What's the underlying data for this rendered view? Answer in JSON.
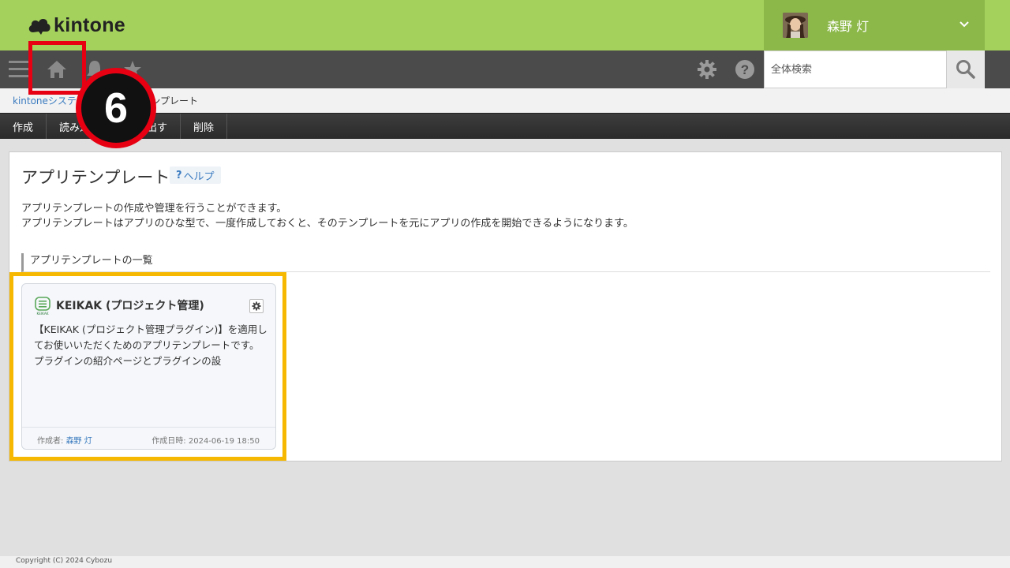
{
  "header": {
    "logo_text": "kintone",
    "user_name": "森野 灯"
  },
  "nav": {
    "icons": [
      "menu-icon",
      "home-icon",
      "bell-icon",
      "star-icon",
      "gear-icon",
      "help-icon",
      "search-icon"
    ],
    "search_placeholder": "全体検索"
  },
  "breadcrumb": {
    "items": [
      "kintoneシステム管理",
      "アプリテンプレート"
    ]
  },
  "actions": [
    "作成",
    "読み込む",
    "書き出す",
    "削除"
  ],
  "main": {
    "title": "アプリテンプレート",
    "help_icon": "?",
    "help_label": "ヘルプ",
    "description_line1": "アプリテンプレートの作成や管理を行うことができます。",
    "description_line2": "アプリテンプレートはアプリのひな型で、一度作成しておくと、そのテンプレートを元にアプリの作成を開始できるようになります。",
    "section_title": "アプリテンプレートの一覧"
  },
  "templates": [
    {
      "title": "KEIKAK (プロジェクト管理)",
      "icon_label": "KEIKAK",
      "description": "【KEIKAK (プロジェクト管理プラグイン)】を適用してお使いいただくためのアプリテンプレートです。プラグインの紹介ページとプラグインの設",
      "author_label": "作成者:",
      "author": "森野 灯",
      "date_label": "作成日時:",
      "date": "2024-06-19 18:50"
    }
  ],
  "annotation": {
    "step_number": "6",
    "home_highlight_color": "#e60012",
    "card_highlight_color": "#f6b800"
  },
  "footer": {
    "copyright": "Copyright (C) 2024 Cybozu"
  },
  "colors": {
    "header_green": "#a4d15c",
    "user_box_green": "#8cb84a",
    "nav_dark": "#4b4b4b",
    "link_blue": "#3a7bbf"
  }
}
